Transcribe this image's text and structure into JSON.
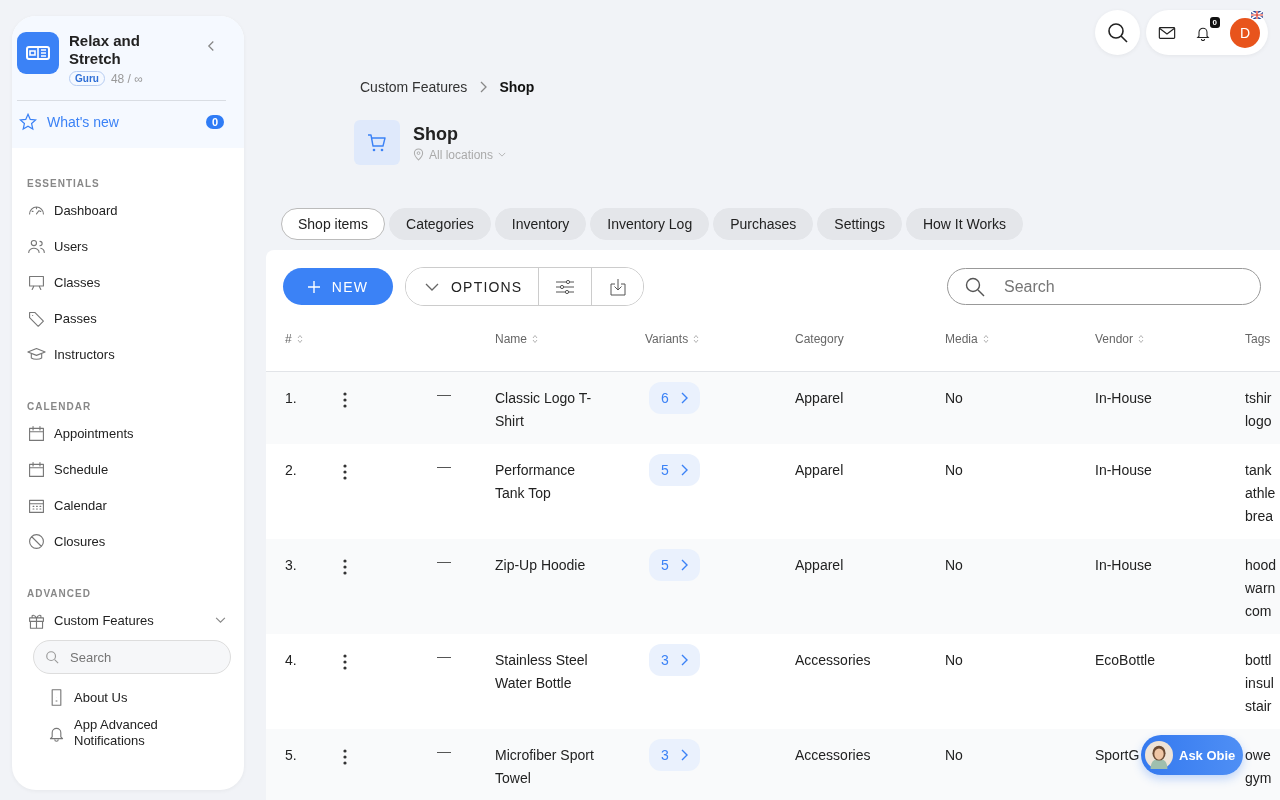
{
  "sidebar": {
    "workspace": {
      "name": "Relax and Stretch",
      "plan": "Guru",
      "usage": "48 / ∞"
    },
    "whats_new": {
      "label": "What's new",
      "count": "0"
    },
    "sections": [
      {
        "title": "ESSENTIALS",
        "items": [
          {
            "label": "Dashboard"
          },
          {
            "label": "Users"
          },
          {
            "label": "Classes"
          },
          {
            "label": "Passes"
          },
          {
            "label": "Instructors"
          }
        ]
      },
      {
        "title": "CALENDAR",
        "items": [
          {
            "label": "Appointments"
          },
          {
            "label": "Schedule"
          },
          {
            "label": "Calendar"
          },
          {
            "label": "Closures"
          }
        ]
      },
      {
        "title": "ADVANCED",
        "items": [
          {
            "label": "Custom Features",
            "expanded": true,
            "search_placeholder": "Search",
            "children": [
              {
                "label": "About Us"
              },
              {
                "label": "App Advanced Notifications"
              }
            ]
          }
        ]
      }
    ]
  },
  "topbar": {
    "notification_count": "0",
    "avatar_initial": "D"
  },
  "breadcrumb": [
    {
      "label": "Custom Features",
      "current": false
    },
    {
      "label": "Shop",
      "current": true
    }
  ],
  "page": {
    "title": "Shop",
    "location": "All locations"
  },
  "tabs": [
    {
      "label": "Shop items",
      "selected": true
    },
    {
      "label": "Categories",
      "selected": false
    },
    {
      "label": "Inventory",
      "selected": false
    },
    {
      "label": "Inventory Log",
      "selected": false
    },
    {
      "label": "Purchases",
      "selected": false
    },
    {
      "label": "Settings",
      "selected": false
    },
    {
      "label": "How It Works",
      "selected": false
    }
  ],
  "toolbar": {
    "new_label": "NEW",
    "options_label": "OPTIONS",
    "search_placeholder": "Search"
  },
  "table": {
    "columns": [
      {
        "label": "#",
        "sortable": true
      },
      {
        "label": "Name",
        "sortable": true
      },
      {
        "label": "Variants",
        "sortable": true
      },
      {
        "label": "Category",
        "sortable": false
      },
      {
        "label": "Media",
        "sortable": true
      },
      {
        "label": "Vendor",
        "sortable": true
      },
      {
        "label": "Tags",
        "sortable": false
      }
    ],
    "rows": [
      {
        "number": "1.",
        "column_3": "—",
        "name": "Classic Logo T-Shirt",
        "variants": "6",
        "category": "Apparel",
        "media": "No",
        "vendor": "In-House",
        "tags": [
          "tshir",
          "logo"
        ]
      },
      {
        "number": "2.",
        "column_3": "—",
        "name": "Performance Tank Top",
        "variants": "5",
        "category": "Apparel",
        "media": "No",
        "vendor": "In-House",
        "tags": [
          "tank",
          "athle",
          "brea"
        ]
      },
      {
        "number": "3.",
        "column_3": "—",
        "name": "Zip-Up Hoodie",
        "variants": "5",
        "category": "Apparel",
        "media": "No",
        "vendor": "In-House",
        "tags": [
          "hood",
          "warn",
          "com"
        ]
      },
      {
        "number": "4.",
        "column_3": "—",
        "name": "Stainless Steel Water Bottle",
        "variants": "3",
        "category": "Accessories",
        "media": "No",
        "vendor": "EcoBottle",
        "tags": [
          "bottl",
          "insul",
          "stair"
        ]
      },
      {
        "number": "5.",
        "column_3": "—",
        "name": "Microfiber Sport Towel",
        "variants": "3",
        "category": "Accessories",
        "media": "No",
        "vendor": "SportG",
        "tags": [
          "owe",
          "gym"
        ]
      }
    ]
  },
  "assistant": {
    "label": "Ask Obie"
  }
}
